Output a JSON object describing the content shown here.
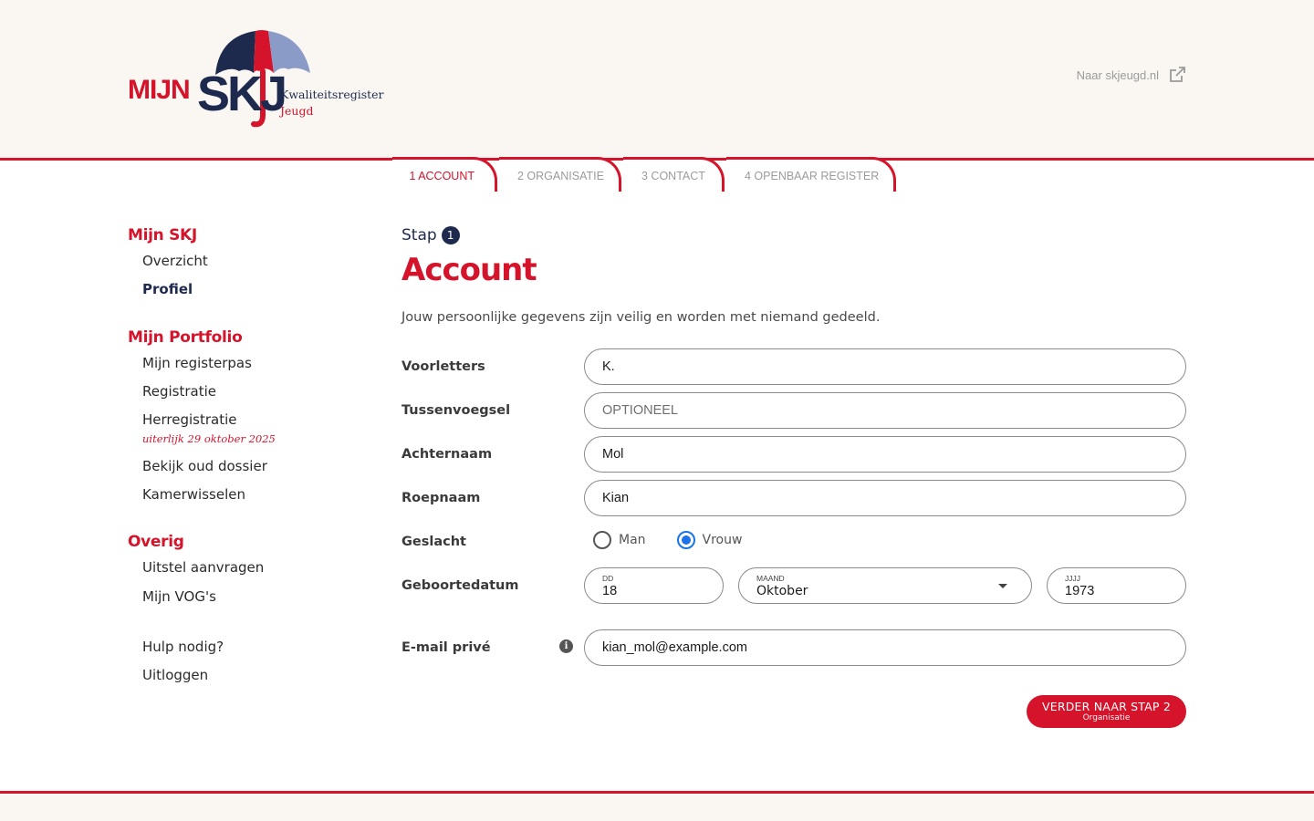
{
  "brand": {
    "mijn": "MIJN",
    "skj": "SKJ",
    "line1": "Kwaliteitsregister",
    "line2": "Jeugd",
    "colors": {
      "red": "#d5132a",
      "navy": "#1d2a4d",
      "blue_light": "#8b9bc8"
    }
  },
  "header": {
    "external_link_label": "Naar skjeugd.nl",
    "external_icon": "external-link-icon"
  },
  "steps": [
    {
      "label": "1 ACCOUNT",
      "active": true
    },
    {
      "label": "2 ORGANISATIE",
      "active": false
    },
    {
      "label": "3 CONTACT",
      "active": false
    },
    {
      "label": "4 OPENBAAR REGISTER",
      "active": false
    }
  ],
  "sidebar": {
    "section1": {
      "title": "Mijn SKJ",
      "items": [
        "Overzicht",
        "Profiel"
      ]
    },
    "section2": {
      "title": "Mijn Portfolio",
      "items": [
        "Mijn registerpas",
        "Registratie",
        "Herregistratie",
        "Bekijk oud dossier",
        "Kamerwisselen"
      ],
      "herregistratie_note": "uiterlijk 29 oktober 2025"
    },
    "section3": {
      "title": "Overig",
      "items": [
        "Uitstel aanvragen",
        "Mijn VOG's"
      ]
    },
    "bottom": [
      "Hulp nodig?",
      "Uitloggen"
    ]
  },
  "main": {
    "stap_label": "Stap",
    "stap_number": "1",
    "title": "Account",
    "intro": "Jouw persoonlijke gegevens zijn veilig en worden met niemand gedeeld."
  },
  "form": {
    "voorletters": {
      "label": "Voorletters",
      "value": "K."
    },
    "tussenvoegsel": {
      "label": "Tussenvoegsel",
      "value": "",
      "placeholder": "OPTIONEEL"
    },
    "achternaam": {
      "label": "Achternaam",
      "value": "Mol"
    },
    "roepnaam": {
      "label": "Roepnaam",
      "value": "Kian"
    },
    "geslacht": {
      "label": "Geslacht",
      "options": [
        "Man",
        "Vrouw"
      ],
      "selected": "Vrouw"
    },
    "geboortedatum": {
      "label": "Geboortedatum",
      "dd_label": "DD",
      "dd": "18",
      "maand_label": "MAAND",
      "maand": "Oktober",
      "jjjj_label": "JJJJ",
      "jjjj": "1973"
    },
    "email": {
      "label": "E-mail privé",
      "value": "kian_mol@example.com"
    }
  },
  "next_button": {
    "label": "VERDER NAAR STAP 2",
    "sub": "Organisatie"
  }
}
